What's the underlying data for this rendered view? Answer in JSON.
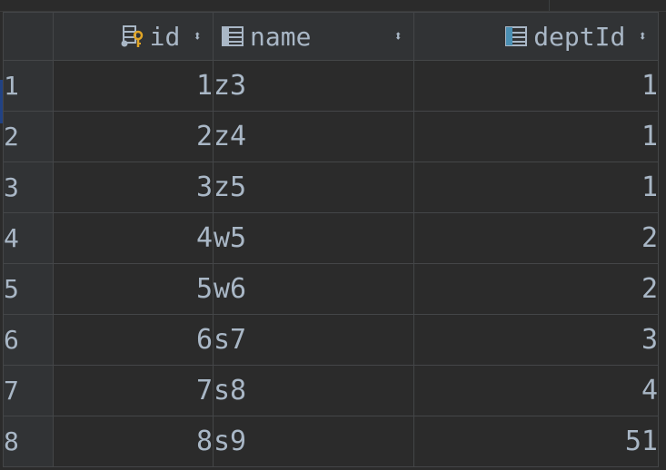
{
  "table": {
    "columns": [
      {
        "label": "id",
        "icon": "primary-key-column-icon",
        "align": "right"
      },
      {
        "label": "name",
        "icon": "column-icon",
        "align": "left"
      },
      {
        "label": "deptId",
        "icon": "column-icon",
        "align": "right"
      }
    ],
    "sort_glyph": "⬍",
    "rows": [
      {
        "n": "1",
        "id": "1",
        "name": "z3",
        "deptId": "1"
      },
      {
        "n": "2",
        "id": "2",
        "name": "z4",
        "deptId": "1"
      },
      {
        "n": "3",
        "id": "3",
        "name": "z5",
        "deptId": "1"
      },
      {
        "n": "4",
        "id": "4",
        "name": "w5",
        "deptId": "2"
      },
      {
        "n": "5",
        "id": "5",
        "name": "w6",
        "deptId": "2"
      },
      {
        "n": "6",
        "id": "6",
        "name": "s7",
        "deptId": "3"
      },
      {
        "n": "7",
        "id": "7",
        "name": "s8",
        "deptId": "4"
      },
      {
        "n": "8",
        "id": "8",
        "name": "s9",
        "deptId": "51"
      }
    ]
  },
  "colors": {
    "background": "#2b2b2b",
    "header": "#313335",
    "text": "#a9b7c6",
    "key_icon": "#e0a526",
    "column_icon_accent": "#4a8fb3"
  }
}
